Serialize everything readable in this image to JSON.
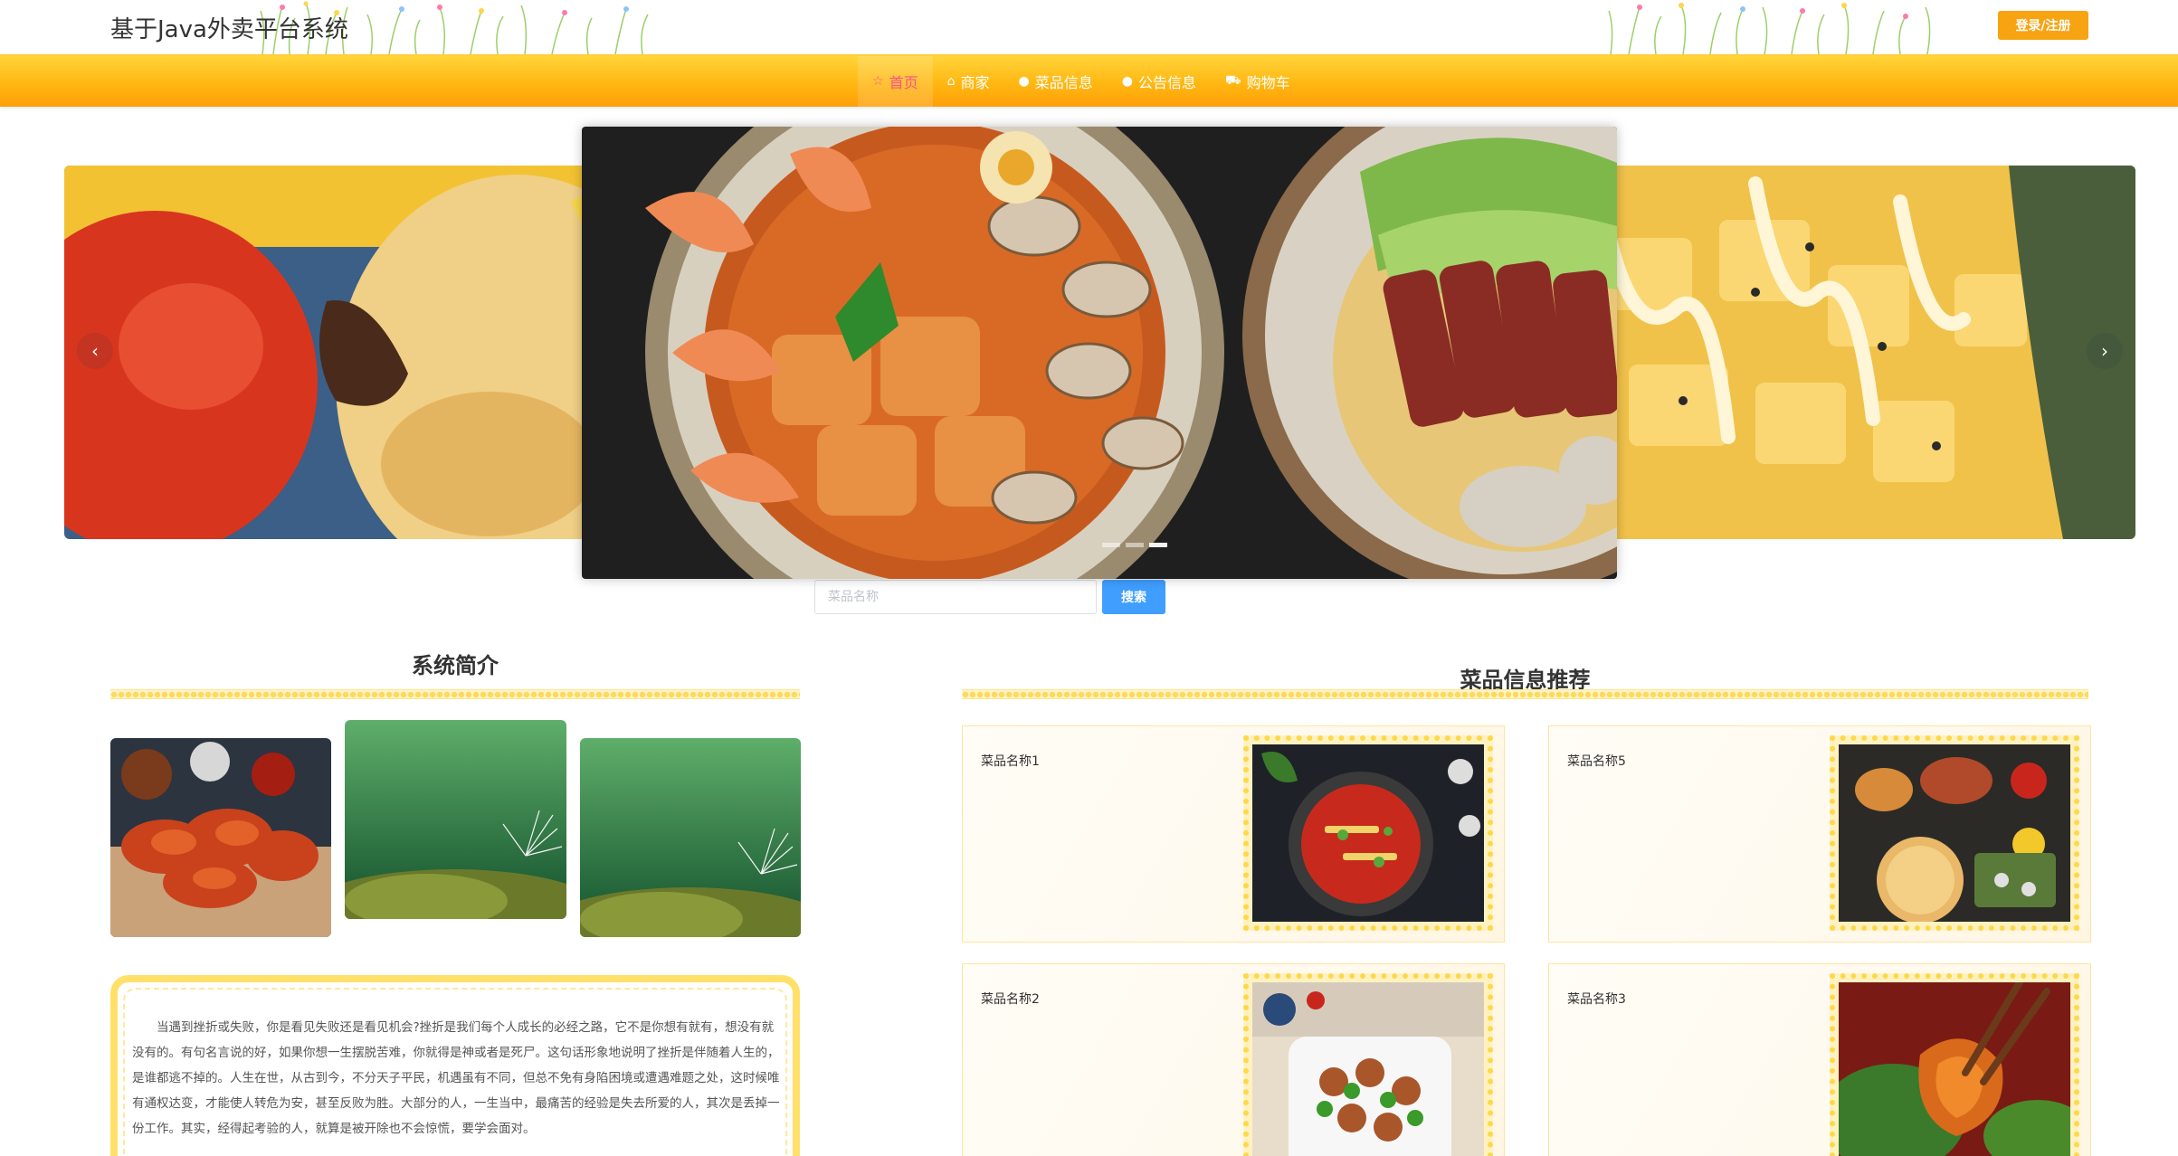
{
  "header": {
    "site_title": "基于Java外卖平台系统",
    "login_label": "登录/注册"
  },
  "nav": {
    "items": [
      {
        "label": "首页",
        "icon": "star-icon",
        "active": true
      },
      {
        "label": "商家",
        "icon": "shop-icon",
        "active": false
      },
      {
        "label": "菜品信息",
        "icon": "info-icon",
        "active": false
      },
      {
        "label": "公告信息",
        "icon": "info-icon",
        "active": false
      },
      {
        "label": "购物车",
        "icon": "cart-icon",
        "active": false
      }
    ]
  },
  "carousel": {
    "prev_icon": "chevron-left-icon",
    "next_icon": "chevron-right-icon",
    "indicator_count": 3,
    "active_index": 2
  },
  "search": {
    "placeholder": "菜品名称",
    "button_label": "搜索"
  },
  "intro": {
    "title": "系统简介",
    "text": "当遇到挫折或失败，你是看见失败还是看见机会?挫折是我们每个人成长的必经之路，它不是你想有就有，想没有就没有的。有句名言说的好，如果你想一生摆脱苦难，你就得是神或者是死尸。这句话形象地说明了挫折是伴随着人生的，是谁都逃不掉的。人生在世，从古到今，不分天子平民，机遇虽有不同，但总不免有身陷困境或遭遇难题之处，这时候唯有通权达变，才能使人转危为安，甚至反败为胜。大部分的人，一生当中，最痛苦的经验是失去所爱的人，其次是丢掉一份工作。其实，经得起考验的人，就算是被开除也不会惊慌，要学会面对。"
  },
  "recommend": {
    "title": "菜品信息推荐",
    "items": [
      {
        "name": "菜品名称1"
      },
      {
        "name": "菜品名称5"
      },
      {
        "name": "菜品名称2"
      },
      {
        "name": "菜品名称3"
      }
    ]
  },
  "colors": {
    "accent": "#f7a312",
    "nav_active": "#ff4f8b",
    "search_button": "#409eff",
    "border_yellow": "#ffe16a"
  }
}
